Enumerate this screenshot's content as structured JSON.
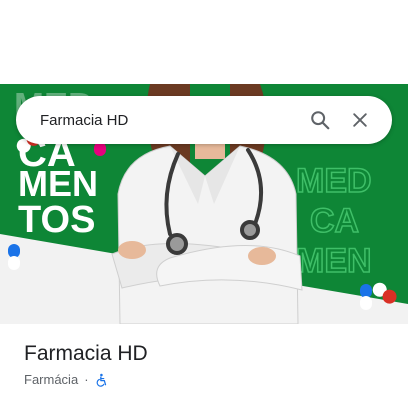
{
  "search": {
    "query": "Farmacia HD"
  },
  "hero": {
    "promo_text_lines": [
      "MED",
      "CA",
      "MEN",
      "TOS"
    ],
    "colors": {
      "green": "#0f8f3a",
      "dark_green": "#0a6d2b",
      "coat": "#f3f3f3"
    },
    "icon_names": [
      "doctor-photo",
      "stethoscope",
      "pill-capsule"
    ]
  },
  "place": {
    "title": "Farmacia HD",
    "category": "Farmácia",
    "separator": "·",
    "accessibility_icon": "wheelchair-icon",
    "accent_color": "#1a73e8"
  },
  "icons": {
    "search": "search-icon",
    "close": "close-icon"
  }
}
